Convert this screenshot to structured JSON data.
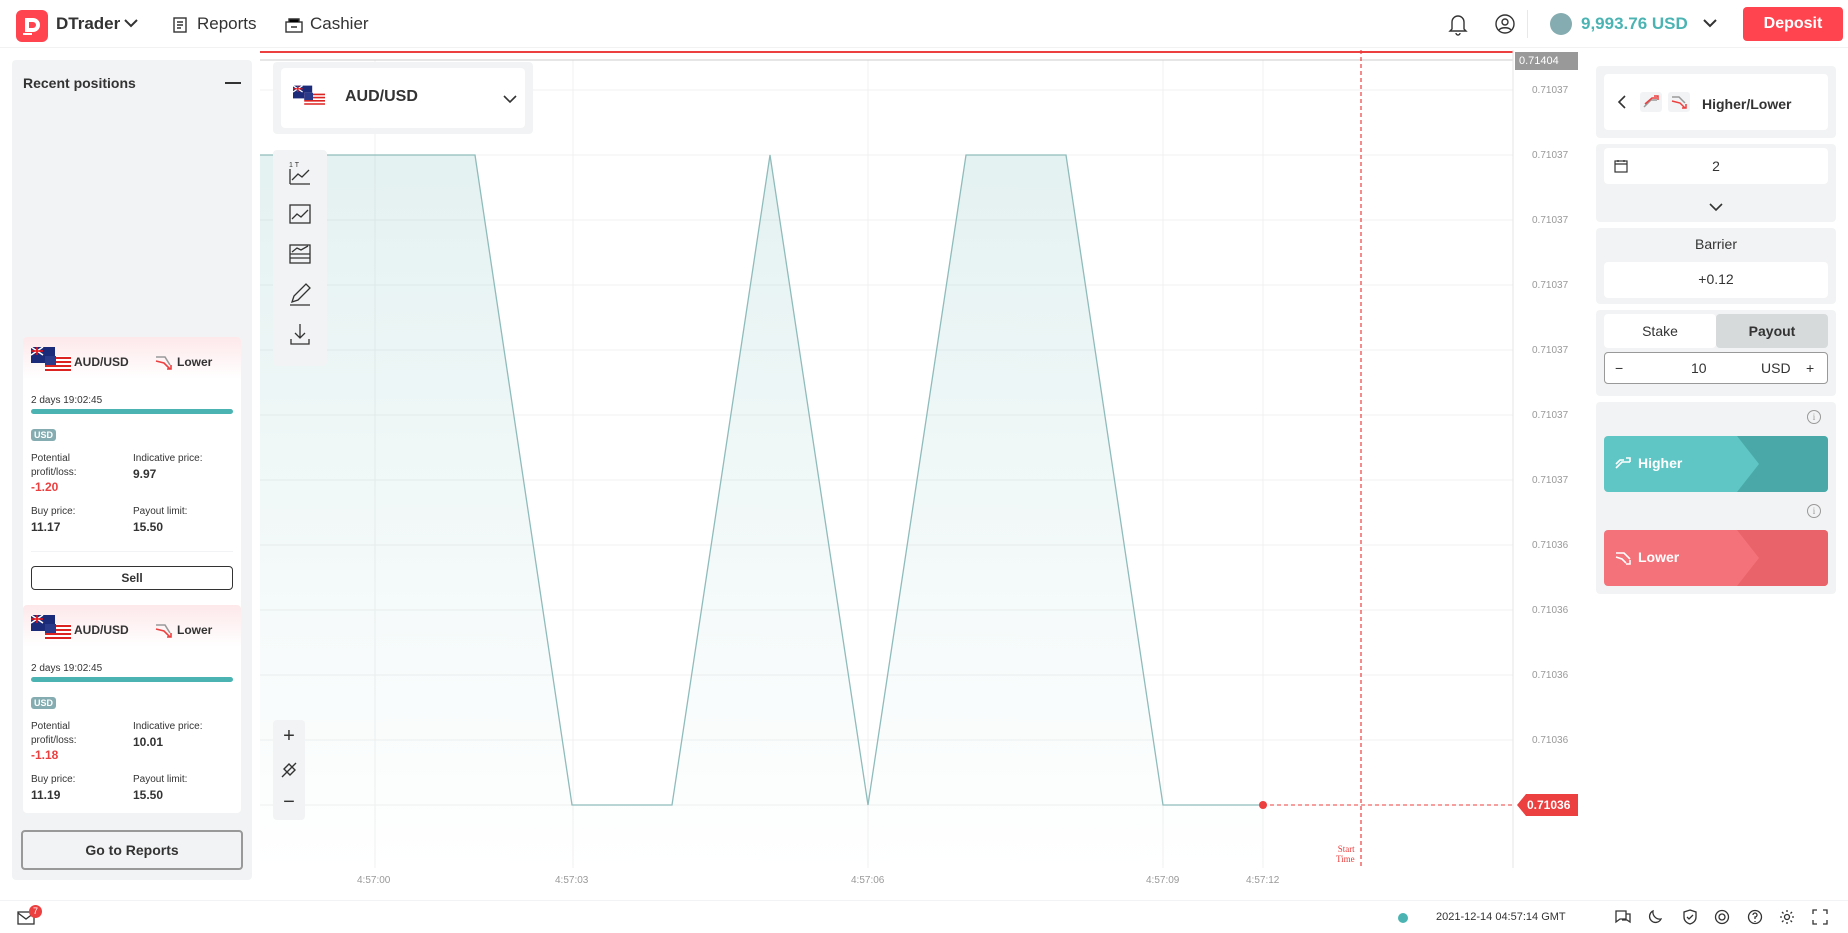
{
  "header": {
    "app_name": "DTrader",
    "nav": {
      "reports": "Reports",
      "cashier": "Cashier"
    },
    "balance": "9,993.76 USD",
    "deposit": "Deposit"
  },
  "recent": {
    "title": "Recent positions",
    "positions": [
      {
        "symbol": "AUD/USD",
        "type": "Lower",
        "time_left": "2 days 19:02:45",
        "currency": "USD",
        "pl_label": "Potential profit/loss:",
        "pl": "-1.20",
        "ind_label": "Indicative price:",
        "ind": "9.97",
        "buy_label": "Buy price:",
        "buy": "11.17",
        "payout_label": "Payout limit:",
        "payout": "15.50",
        "sell": "Sell"
      },
      {
        "symbol": "AUD/USD",
        "type": "Lower",
        "time_left": "2 days 19:02:45",
        "currency": "USD",
        "pl_label": "Potential profit/loss:",
        "pl": "-1.18",
        "ind_label": "Indicative price:",
        "ind": "10.01",
        "buy_label": "Buy price:",
        "buy": "11.19",
        "payout_label": "Payout limit:",
        "payout": "15.50"
      }
    ],
    "go_reports": "Go to Reports"
  },
  "chart": {
    "market": "AUD/USD",
    "top_price": "0.71404",
    "current_price": "0.71036",
    "y_labels": [
      "0.71037",
      "0.71037",
      "0.71037",
      "0.71037",
      "0.71037",
      "0.71037",
      "0.71037",
      "0.71036",
      "0.71036",
      "0.71036",
      "0.71036"
    ],
    "x_labels": [
      "4:57:00",
      "4:57:03",
      "4:57:06",
      "4:57:09",
      "4:57:12"
    ],
    "start_time_1": "Start",
    "start_time_2": "Time",
    "tool_label": "1 T"
  },
  "trade": {
    "contract": "Higher/Lower",
    "duration": "2",
    "barrier_label": "Barrier",
    "barrier": "+0.12",
    "stake": "Stake",
    "payout": "Payout",
    "amount": "10",
    "currency": "USD",
    "higher": "Higher",
    "lower": "Lower"
  },
  "footer": {
    "notif_count": "7",
    "datetime": "2021-12-14 04:57:14 GMT"
  },
  "colors": {
    "brand": "#ff444f",
    "teal": "#4bb4b3",
    "loss": "#ec3f3f",
    "higher": "#4bb4b3",
    "lower": "#ec3f3f"
  }
}
